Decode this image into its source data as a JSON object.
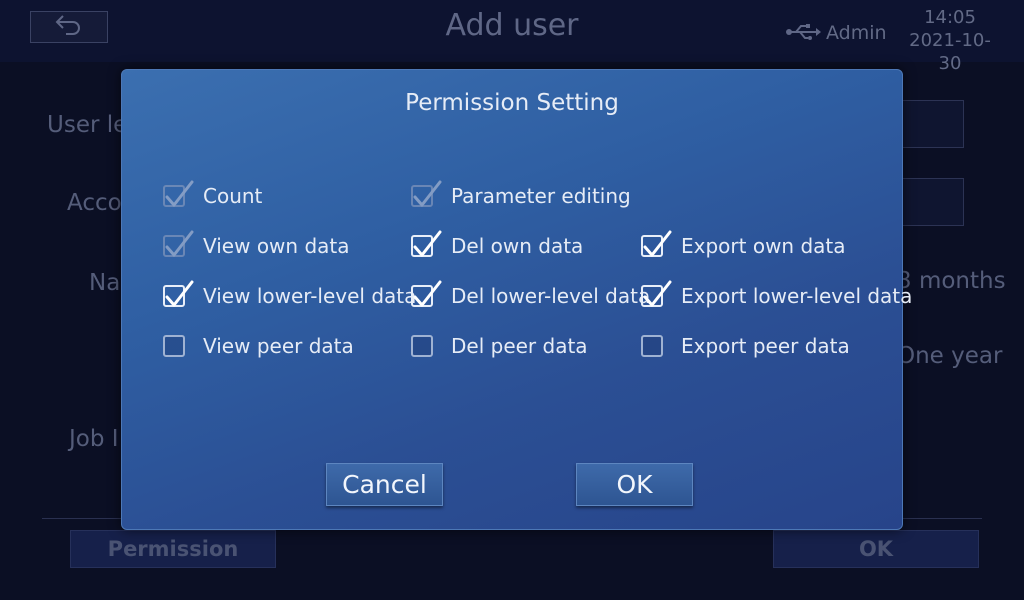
{
  "header": {
    "title": "Add user",
    "user": "Admin",
    "time": "14:05",
    "date": "2021-10-30"
  },
  "background": {
    "labels": {
      "user_level": "User le",
      "account": "Acco",
      "name": "Na",
      "job": "Job I",
      "months": "3 months",
      "year": "One year"
    },
    "permission_button": "Permission",
    "ok_button": "OK"
  },
  "dialog": {
    "title": "Permission Setting",
    "cancel_label": "Cancel",
    "ok_label": "OK",
    "permissions": [
      {
        "label": "Count",
        "checked": true,
        "disabled": true
      },
      {
        "label": "Parameter editing",
        "checked": true,
        "disabled": true
      },
      {
        "label": "View own data",
        "checked": true,
        "disabled": true
      },
      {
        "label": "Del own data",
        "checked": true,
        "disabled": false
      },
      {
        "label": "Export own data",
        "checked": true,
        "disabled": false
      },
      {
        "label": "View lower-level data",
        "checked": true,
        "disabled": false
      },
      {
        "label": "Del lower-level data",
        "checked": true,
        "disabled": false
      },
      {
        "label": "Export lower-level data",
        "checked": true,
        "disabled": false
      },
      {
        "label": "View peer data",
        "checked": false,
        "disabled": false
      },
      {
        "label": "Del peer data",
        "checked": false,
        "disabled": false
      },
      {
        "label": "Export peer data",
        "checked": false,
        "disabled": false
      }
    ]
  },
  "colors": {
    "dialog_top": "#3b6fb0",
    "dialog_bottom": "#27448a",
    "screen_bg": "#0b0f24"
  }
}
